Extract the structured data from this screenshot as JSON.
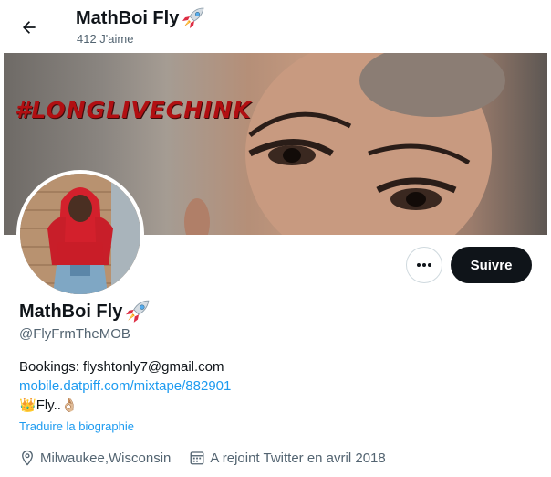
{
  "header": {
    "display_name": "MathBoi Fly",
    "likes_count": "412 J'aime"
  },
  "banner": {
    "overlay_text": "#LONGLIVECHINK"
  },
  "actions": {
    "follow_label": "Suivre"
  },
  "profile": {
    "display_name": "MathBoi Fly",
    "handle": "@FlyFrmTheMOB",
    "bio": {
      "line1": "Bookings: flyshtonly7@gmail.com",
      "link": "mobile.datpiff.com/mixtape/882901",
      "line3_emoji": "👑",
      "line3_text": "Fly..",
      "line3_tail_emoji": "👌🏼"
    },
    "translate_label": "Traduire la biographie",
    "location": "Milwaukee,Wisconsin",
    "joined": "A rejoint Twitter en avril 2018"
  },
  "icons": [
    "back-arrow-icon",
    "rocket-icon",
    "more-dots-icon",
    "location-pin-icon",
    "calendar-icon"
  ],
  "colors": {
    "accent": "#1d9bf0",
    "follow_bg": "#0f1419",
    "secondary_text": "#536471"
  }
}
